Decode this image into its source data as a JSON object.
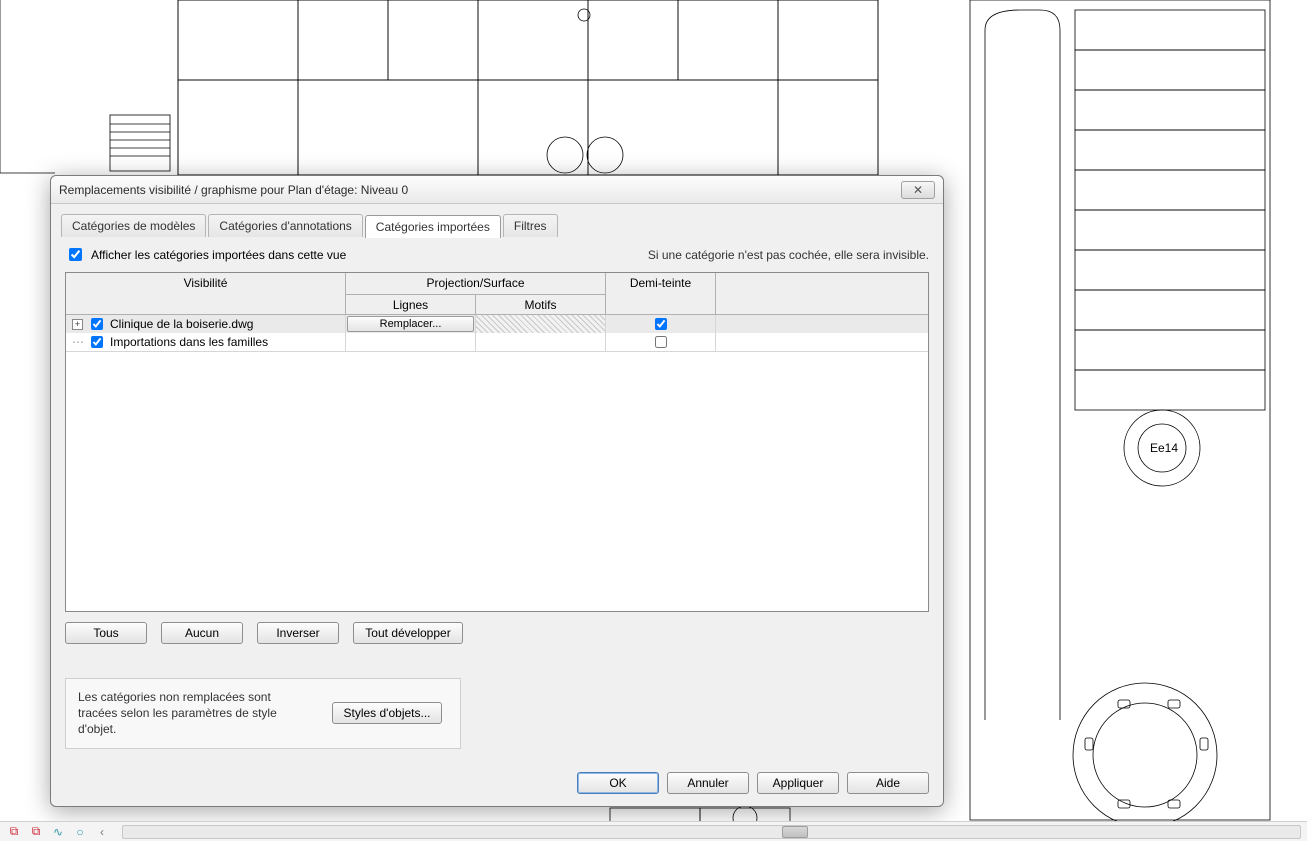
{
  "dialog": {
    "title": "Remplacements visibilité / graphisme pour Plan d'étage: Niveau 0",
    "tabs": {
      "models": "Catégories de modèles",
      "annotations": "Catégories d'annotations",
      "imported": "Catégories importées",
      "filters": "Filtres"
    },
    "show_categories_label": "Afficher les catégories importées dans cette vue",
    "hint_invisible": "Si une catégorie n'est pas cochée, elle sera invisible.",
    "headers": {
      "visibility": "Visibilité",
      "projection_surface": "Projection/Surface",
      "lines": "Lignes",
      "patterns": "Motifs",
      "halftone": "Demi-teinte"
    },
    "rows": [
      {
        "name": "Clinique de la boiserie.dwg",
        "checked": true,
        "halftone": true,
        "lines_override_label": "Remplacer...",
        "hatched_motif": true,
        "expanded": false,
        "selected": true
      },
      {
        "name": "Importations dans les familles",
        "checked": true,
        "halftone": false,
        "lines_override_label": "",
        "hatched_motif": false,
        "expanded": false,
        "selected": false
      }
    ],
    "buttons": {
      "all": "Tous",
      "none": "Aucun",
      "invert": "Inverser",
      "expand_all": "Tout développer"
    },
    "footer_note": "Les catégories non remplacées sont tracées selon les paramètres de style d'objet.",
    "object_styles": "Styles d'objets...",
    "ok": "OK",
    "cancel": "Annuler",
    "apply": "Appliquer",
    "help": "Aide"
  }
}
